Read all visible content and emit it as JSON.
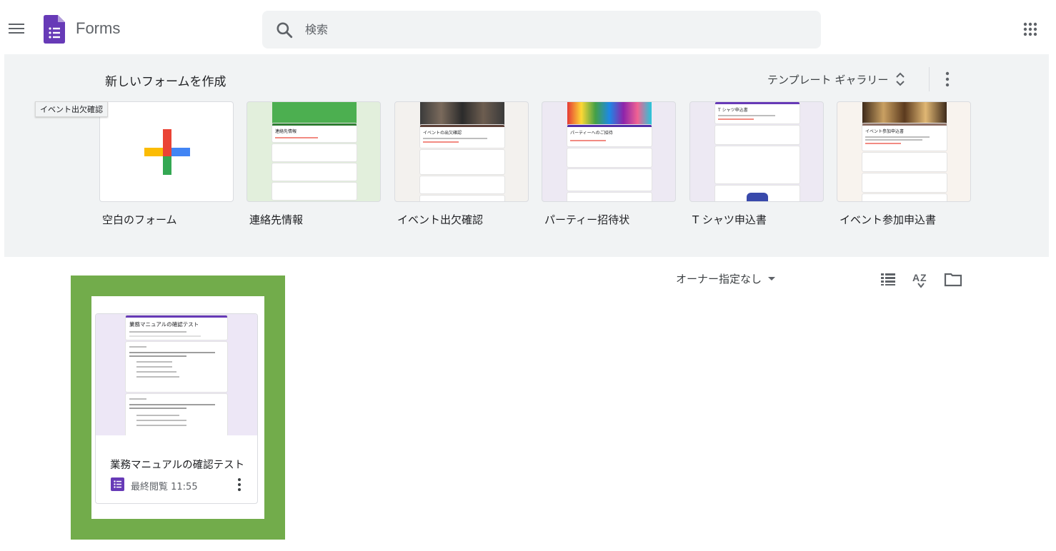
{
  "header": {
    "app_title": "Forms",
    "search_placeholder": "検索"
  },
  "templates": {
    "title": "新しいフォームを作成",
    "gallery_label": "テンプレート ギャラリー",
    "tooltip": "イベント出欠確認",
    "items": [
      {
        "label": "空白のフォーム"
      },
      {
        "label": "連絡先情報",
        "form_title": "連絡先情報"
      },
      {
        "label": "イベント出欠確認",
        "form_title": "イベントの出欠確認"
      },
      {
        "label": "パーティー招待状",
        "form_title": "パーティーへのご招待"
      },
      {
        "label": "T シャツ申込書",
        "form_title": "T シャツ申込書"
      },
      {
        "label": "イベント参加申込書",
        "form_title": "イベント参加申込書"
      }
    ]
  },
  "recent": {
    "owner_filter": "オーナー指定なし",
    "documents": [
      {
        "title": "業務マニュアルの確認テスト",
        "thumb_title": "業務マニュアルの確認テスト",
        "meta": "最終閲覧 11:55"
      }
    ]
  },
  "colors": {
    "forms_purple": "#673ab7",
    "highlight_green": "#72ac4b",
    "band_bg": "#f1f3f4"
  }
}
